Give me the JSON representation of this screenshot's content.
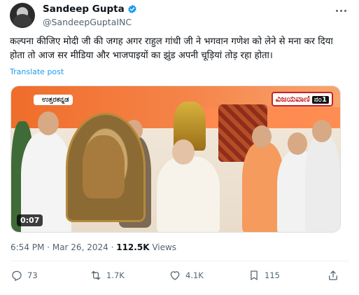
{
  "author": {
    "name": "Sandeep Gupta",
    "handle": "@SandeepGuptaINC"
  },
  "post": {
    "text": "कल्पना कीजिए मोदी जी की जगह अगर राहुल गांधी जी ने भगवान गणेश को लेने से मना कर दिया होता तो आज सर मीडिया और भाजपाइयों का झुंड अपनी चूड़ियां तोड़ रहा होता।",
    "translate_label": "Translate post"
  },
  "media": {
    "location_badge": "ಉತ್ತರಕನ್ನಡ",
    "channel_label": "ವಿಜಯವಾಣಿ",
    "channel_number": "ನ೦1",
    "duration": "0:07"
  },
  "meta": {
    "time": "6:54 PM",
    "date": "Mar 26, 2024",
    "separator": "·",
    "views_count": "112.5K",
    "views_label": "Views"
  },
  "actions": {
    "replies": "73",
    "reposts": "1.7K",
    "likes": "4.1K",
    "bookmarks": "115"
  },
  "colors": {
    "accent": "#1d9bf0",
    "text": "#0f1419",
    "muted": "#536471"
  },
  "icons": [
    "verified-icon",
    "more-icon",
    "reply-icon",
    "repost-icon",
    "like-icon",
    "bookmark-icon",
    "share-icon"
  ]
}
